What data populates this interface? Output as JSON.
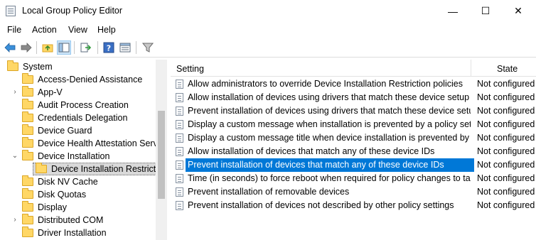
{
  "window": {
    "title": "Local Group Policy Editor",
    "controls": {
      "minimize": "—",
      "maximize": "☐",
      "close": "✕"
    }
  },
  "menu": [
    "File",
    "Action",
    "View",
    "Help"
  ],
  "toolbar": {
    "icons": [
      "back-arrow-icon",
      "forward-arrow-icon",
      "up-folder-icon",
      "show-hide-tree-icon",
      "export-list-icon",
      "help-icon",
      "properties-view-icon",
      "filter-icon"
    ]
  },
  "tree": {
    "items": [
      {
        "label": "System",
        "expander": "",
        "selected": false
      },
      {
        "label": "Access-Denied Assistance",
        "expander": "",
        "selected": false
      },
      {
        "label": "App-V",
        "expander": "›",
        "selected": false
      },
      {
        "label": "Audit Process Creation",
        "expander": "",
        "selected": false
      },
      {
        "label": "Credentials Delegation",
        "expander": "",
        "selected": false
      },
      {
        "label": "Device Guard",
        "expander": "",
        "selected": false
      },
      {
        "label": "Device Health Attestation Servic",
        "expander": "",
        "selected": false
      },
      {
        "label": "Device Installation",
        "expander": "⌄",
        "selected": false
      },
      {
        "label": "Device Installation Restrictio",
        "expander": "",
        "selected": true
      },
      {
        "label": "Disk NV Cache",
        "expander": "",
        "selected": false
      },
      {
        "label": "Disk Quotas",
        "expander": "",
        "selected": false
      },
      {
        "label": "Display",
        "expander": "",
        "selected": false
      },
      {
        "label": "Distributed COM",
        "expander": "›",
        "selected": false
      },
      {
        "label": "Driver Installation",
        "expander": "",
        "selected": false
      }
    ]
  },
  "list": {
    "columns": {
      "setting": "Setting",
      "state": "State"
    },
    "rows": [
      {
        "setting": "Allow administrators to override Device Installation Restriction policies",
        "state": "Not configured"
      },
      {
        "setting": "Allow installation of devices using drivers that match these device setup c...",
        "state": "Not configured"
      },
      {
        "setting": "Prevent installation of devices using drivers that match these device setu...",
        "state": "Not configured"
      },
      {
        "setting": "Display a custom message when installation is prevented by a policy setti...",
        "state": "Not configured"
      },
      {
        "setting": "Display a custom message title when device installation is prevented by a ...",
        "state": "Not configured"
      },
      {
        "setting": "Allow installation of devices that match any of these device IDs",
        "state": "Not configured"
      },
      {
        "setting": "Prevent installation of devices that match any of these device IDs",
        "state": "Not configured",
        "selected": true
      },
      {
        "setting": "Time (in seconds) to force reboot when required for policy changes to ta...",
        "state": "Not configured"
      },
      {
        "setting": "Prevent installation of removable devices",
        "state": "Not configured"
      },
      {
        "setting": "Prevent installation of devices not described by other policy settings",
        "state": "Not configured"
      }
    ]
  },
  "colors": {
    "selection": "#0078d7",
    "folder": "#ffd766",
    "tree_selection": "#d9d9d9"
  }
}
